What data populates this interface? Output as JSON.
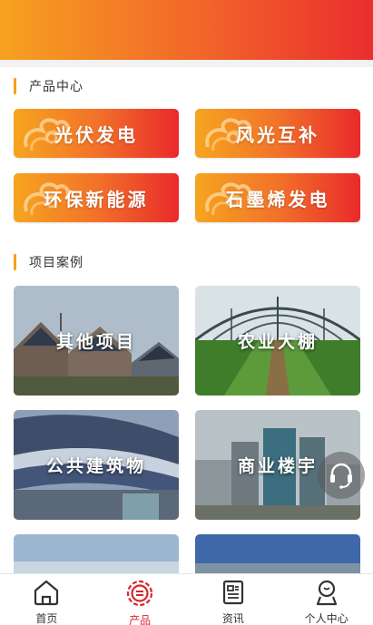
{
  "colors": {
    "accent_orange": "#f6a220",
    "accent_red": "#ea2e2e",
    "active_tab": "#d8262c"
  },
  "products": {
    "title": "产品中心",
    "items": [
      {
        "label": "光伏发电"
      },
      {
        "label": "风光互补"
      },
      {
        "label": "环保新能源"
      },
      {
        "label": "石墨烯发电"
      }
    ]
  },
  "cases": {
    "title": "项目案例",
    "items": [
      {
        "label": "其他项目"
      },
      {
        "label": "农业大棚"
      },
      {
        "label": "公共建筑物"
      },
      {
        "label": "商业楼宇"
      }
    ]
  },
  "service_button": {
    "icon": "headset-icon"
  },
  "tabbar": {
    "items": [
      {
        "label": "首页",
        "icon": "home-icon",
        "active": false
      },
      {
        "label": "产品",
        "icon": "product-icon",
        "active": true
      },
      {
        "label": "资讯",
        "icon": "news-icon",
        "active": false
      },
      {
        "label": "个人中心",
        "icon": "user-icon",
        "active": false
      }
    ]
  }
}
